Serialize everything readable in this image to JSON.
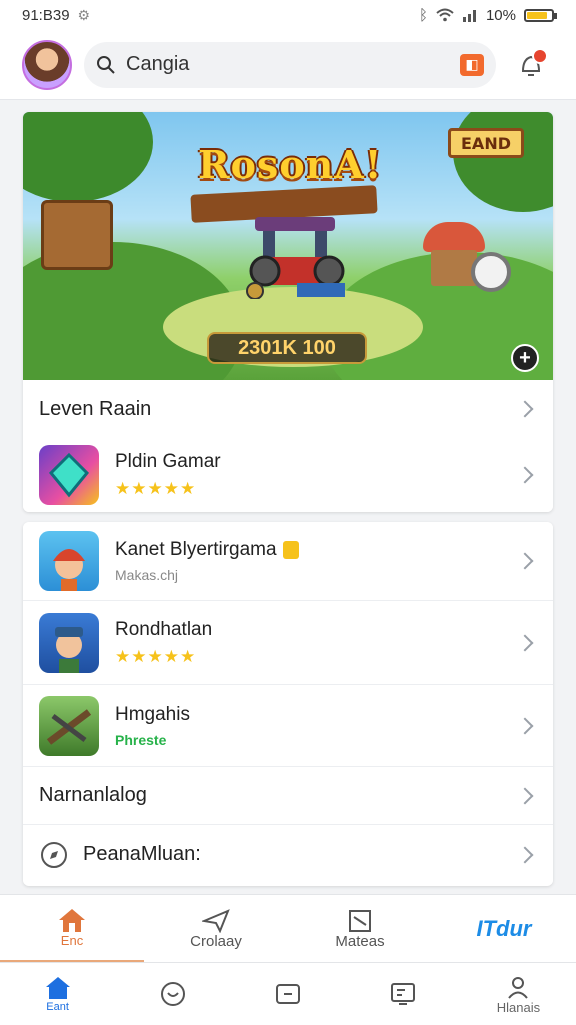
{
  "status_bar": {
    "time": "91:B39",
    "battery": "10%"
  },
  "search": {
    "value": "Cangia"
  },
  "banner": {
    "title": "RosonA!",
    "sign": "EAND",
    "score": "2301K 100"
  },
  "section_header": {
    "label": "Leven Raain"
  },
  "featured_game": {
    "name": "Pldin Gamar",
    "stars": "★★★★★"
  },
  "games": [
    {
      "name": "Kanet Blyertirgama",
      "sub": "Makas.chj"
    },
    {
      "name": "Rondhatlan",
      "stars": "★★★★★"
    },
    {
      "name": "Hmgahis",
      "tag": "Phreste"
    }
  ],
  "links": [
    {
      "label": "Narnanlalog"
    },
    {
      "label": "PeanaMluan:"
    }
  ],
  "subnav": [
    {
      "label": "Enc"
    },
    {
      "label": "Crolaay"
    },
    {
      "label": "Mateas"
    },
    {
      "label": "ITdur"
    }
  ],
  "tabbar": [
    {
      "label": "Eant"
    },
    {
      "label": ""
    },
    {
      "label": ""
    },
    {
      "label": ""
    },
    {
      "label": "Hlanais"
    }
  ],
  "colors": {
    "accent": "#1d8ce6",
    "star": "#f6c21b",
    "notification": "#e6452f",
    "home_icon": "#e0763c"
  }
}
